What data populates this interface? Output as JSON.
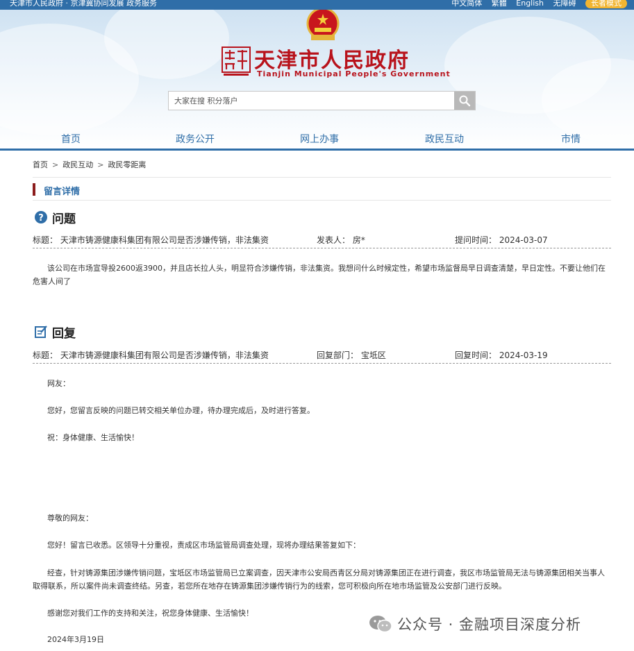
{
  "topbar": {
    "left_text": "天津市人民政府  ·  京津冀协同发展 政务服务",
    "links": [
      "中文简体",
      "繁體",
      "English",
      "无障碍"
    ],
    "badge": "长者模式"
  },
  "header": {
    "logo_cn": "天津市人民政府",
    "logo_en": "Tianjin Municipal People's Government",
    "search_placeholder": "大家在搜 积分落户"
  },
  "nav": [
    "首页",
    "政务公开",
    "网上办事",
    "政民互动",
    "市情"
  ],
  "breadcrumb": [
    "首页",
    "政民互动",
    "政民零距离"
  ],
  "section_title": "留言详情",
  "question": {
    "heading": "问题",
    "title_label": "标题：",
    "title": "天津市铸源健康科集团有限公司是否涉嫌传销，非法集资",
    "author_label": "发表人：",
    "author": "房*",
    "date_label": "提问时间：",
    "date": "2024-03-07",
    "body": "该公司在市场宣导投2600返3900，并且店长拉人头，明显符合涉嫌传销，非法集资。我想问什么时候定性，希望市场监督局早日调查清楚，早日定性。不要让他们在危害人间了"
  },
  "reply": {
    "heading": "回复",
    "title_label": "标题：",
    "title": "天津市铸源健康科集团有限公司是否涉嫌传销，非法集资",
    "dept_label": "回复部门：",
    "dept": "宝坻区",
    "date_label": "回复时间：",
    "date": "2024-03-19",
    "p1": "网友：",
    "p2": "您好，您留言反映的问题已转交相关单位办理，待办理完成后，及时进行答复。",
    "p3": "祝：身体健康、生活愉快！",
    "p4": "尊敬的网友：",
    "p5": "您好！留言已收悉。区领导十分重视，责成区市场监管局调查处理，现将办理结果答复如下：",
    "p6": "经查，针对铸源集团涉嫌传销问题，宝坻区市场监管局已立案调查，因天津市公安局西青区分局对铸源集团正在进行调查，我区市场监管局无法与铸源集团相关当事人取得联系，所以案件尚未调查终结。另查，若您所在地存在铸源集团涉嫌传销行为的线索，您可积极向所在地市场监管及公安部门进行反映。",
    "p7": "感谢您对我们工作的支持和关注，祝您身体健康、生活愉快！",
    "p8": "2024年3月19日"
  },
  "watermark": "公众号 · 金融项目深度分析",
  "colors": {
    "brand_blue": "#2f6ea8",
    "brand_red": "#b8121b",
    "accent_dark_red": "#8c1d1d"
  }
}
